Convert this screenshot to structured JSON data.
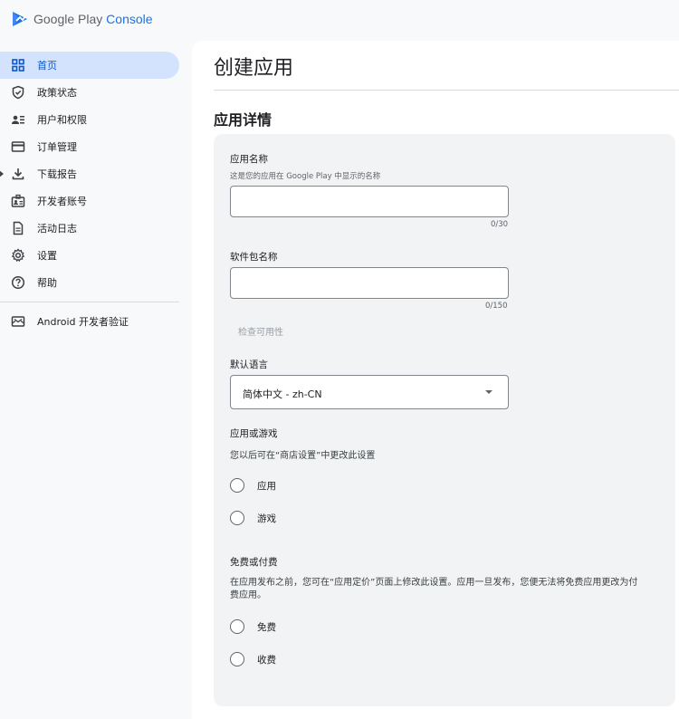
{
  "brand": {
    "name_part1": "Google Play",
    "name_part2": "Console",
    "accent": "#1a73e8"
  },
  "sidebar": {
    "items": [
      {
        "label": "首页",
        "icon": "dashboard-icon",
        "active": true
      },
      {
        "label": "政策状态",
        "icon": "shield-check-icon"
      },
      {
        "label": "用户和权限",
        "icon": "people-list-icon"
      },
      {
        "label": "订单管理",
        "icon": "credit-card-icon"
      },
      {
        "label": "下载报告",
        "icon": "download-icon",
        "expandable": true
      },
      {
        "label": "开发者账号",
        "icon": "badge-icon"
      },
      {
        "label": "活动日志",
        "icon": "document-icon"
      },
      {
        "label": "设置",
        "icon": "gear-icon"
      },
      {
        "label": "帮助",
        "icon": "help-icon"
      }
    ],
    "footer_item": {
      "label": "Android 开发者验证",
      "icon": "verify-mail-icon"
    }
  },
  "page": {
    "title": "创建应用",
    "section_title": "应用详情"
  },
  "form": {
    "app_name": {
      "label": "应用名称",
      "help": "这是您的应用在 Google Play 中显示的名称",
      "value": "",
      "counter": "0/30"
    },
    "package_name": {
      "label": "软件包名称",
      "value": "",
      "counter": "0/150",
      "check_link": "检查可用性"
    },
    "default_language": {
      "label": "默认语言",
      "selected": "简体中文 - zh-CN"
    },
    "app_or_game": {
      "label": "应用或游戏",
      "description": "您以后可在“商店设置”中更改此设置",
      "options": [
        "应用",
        "游戏"
      ]
    },
    "free_or_paid": {
      "label": "免费或付费",
      "description": "在应用发布之前，您可在“应用定价”页面上修改此设置。应用一旦发布，您便无法将免费应用更改为付费应用。",
      "options": [
        "免费",
        "收费"
      ]
    }
  }
}
